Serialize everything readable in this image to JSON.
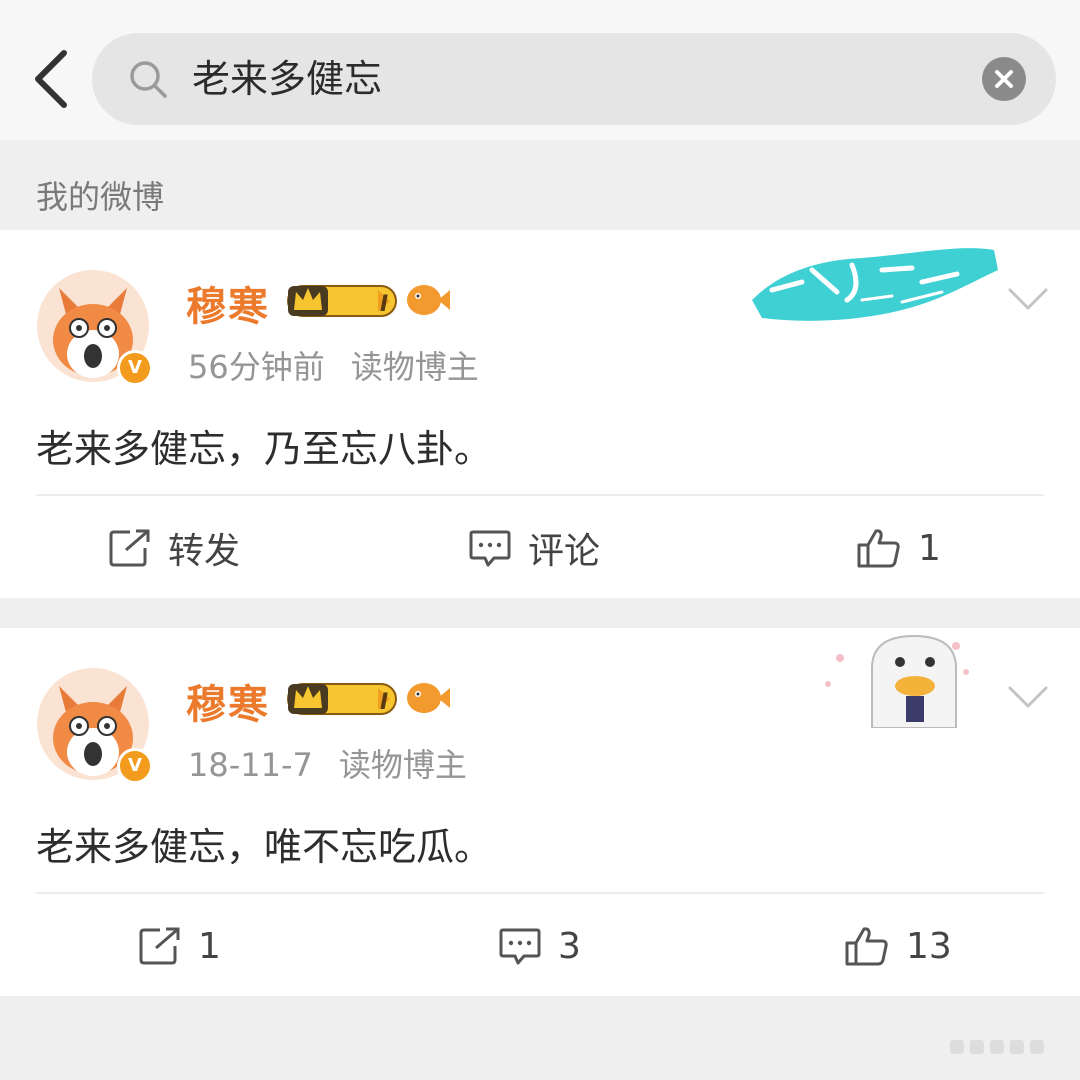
{
  "search": {
    "query": "老来多健忘",
    "placeholder": ""
  },
  "section": {
    "label": "我的微博"
  },
  "posts": [
    {
      "username": "穆寒",
      "badge_level": "I",
      "time": "56分钟前",
      "source": "读物博主",
      "text": "老来多健忘，乃至忘八卦。",
      "repost_label": "转发",
      "comment_label": "评论",
      "like_count": "1",
      "decor_text": "亲子之心乘风破浪"
    },
    {
      "username": "穆寒",
      "badge_level": "I",
      "time": "18-11-7",
      "source": "读物博主",
      "text": "老来多健忘，唯不忘吃瓜。",
      "repost_count": "1",
      "comment_count": "3",
      "like_count": "13"
    }
  ],
  "colors": {
    "username": "#eb7a2c",
    "verified": "#f29b1d",
    "decor_teal": "#3fd0d4",
    "background": "#efefef"
  },
  "icons": [
    "back-arrow-icon",
    "search-icon",
    "clear-icon",
    "crown-badge-icon",
    "fish-badge-icon",
    "chevron-down-icon",
    "repost-icon",
    "comment-icon",
    "like-icon",
    "verified-icon"
  ]
}
